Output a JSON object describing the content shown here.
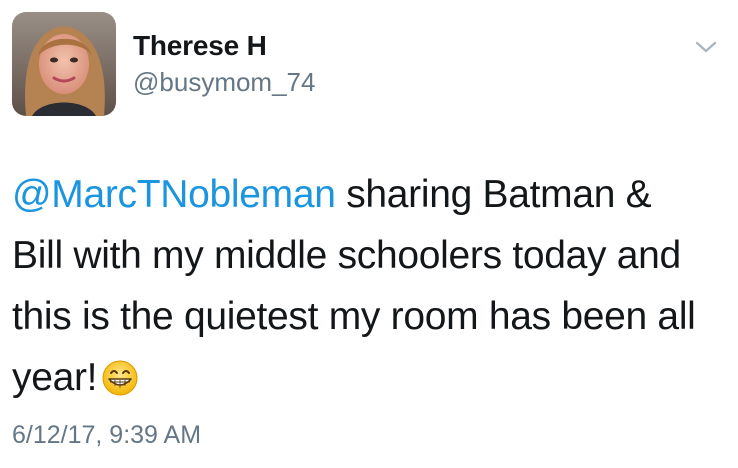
{
  "author": {
    "display_name": "Therese H",
    "handle": "@busymom_74",
    "avatar_icon": "profile-photo"
  },
  "menu": {
    "icon": "chevron-down-icon"
  },
  "tweet": {
    "mention": "@MarcTNobleman",
    "line1_rest": " sharing Batman &",
    "line2": "Bill with my middle schoolers today and",
    "line3": "this is the quietest my room has been all",
    "line4": "year!",
    "emoji_icon": "grinning-face-with-smiling-eyes-icon"
  },
  "timestamp": "6/12/17, 9:39 AM",
  "colors": {
    "text": "#14171a",
    "secondary": "#657786",
    "link": "#1b95e0"
  }
}
